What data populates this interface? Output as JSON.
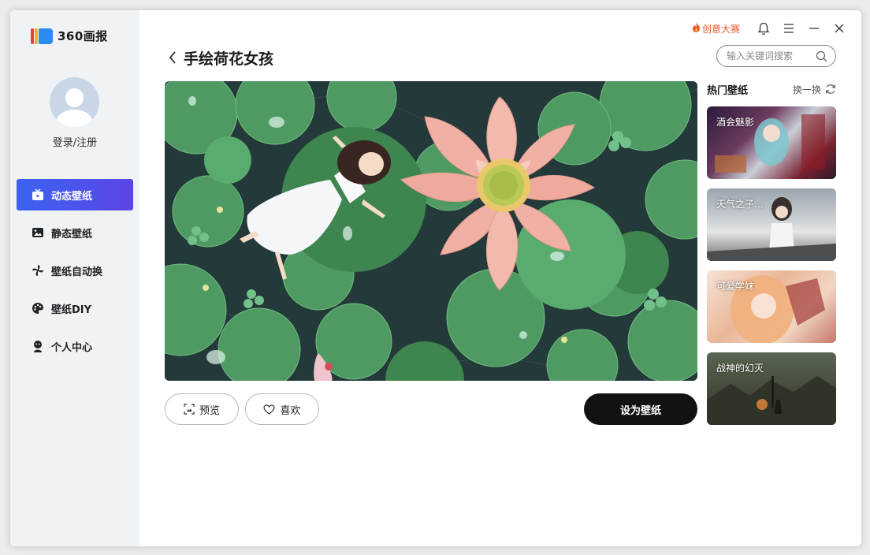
{
  "app": {
    "logo_text": "360画报",
    "colors": {
      "accent_start": "#3a63f2",
      "accent_end": "#5c45e6",
      "set_button": "#121212",
      "contest": "#e0572b"
    }
  },
  "topbar": {
    "contest_label": "创意大赛",
    "icons": [
      "bell-icon",
      "menu-icon",
      "minimize-icon",
      "close-icon"
    ]
  },
  "sidebar": {
    "login_label": "登录/注册",
    "items": [
      {
        "label": "动态壁纸",
        "icon": "tv-icon",
        "active": true
      },
      {
        "label": "静态壁纸",
        "icon": "image-icon",
        "active": false
      },
      {
        "label": "壁纸自动换",
        "icon": "pinwheel-icon",
        "active": false
      },
      {
        "label": "壁纸DIY",
        "icon": "palette-icon",
        "active": false
      },
      {
        "label": "个人中心",
        "icon": "user-icon",
        "active": false
      }
    ]
  },
  "main": {
    "title": "手绘荷花女孩",
    "search_placeholder": "输入关键词搜索",
    "preview_label": "预览",
    "like_label": "喜欢",
    "set_label": "设为壁纸"
  },
  "hot": {
    "title": "热门壁纸",
    "refresh_label": "换一换",
    "items": [
      {
        "caption": "酒会魅影"
      },
      {
        "caption": "天气之子..."
      },
      {
        "caption": "可爱学妹"
      },
      {
        "caption": "战神的幻灭"
      }
    ]
  }
}
